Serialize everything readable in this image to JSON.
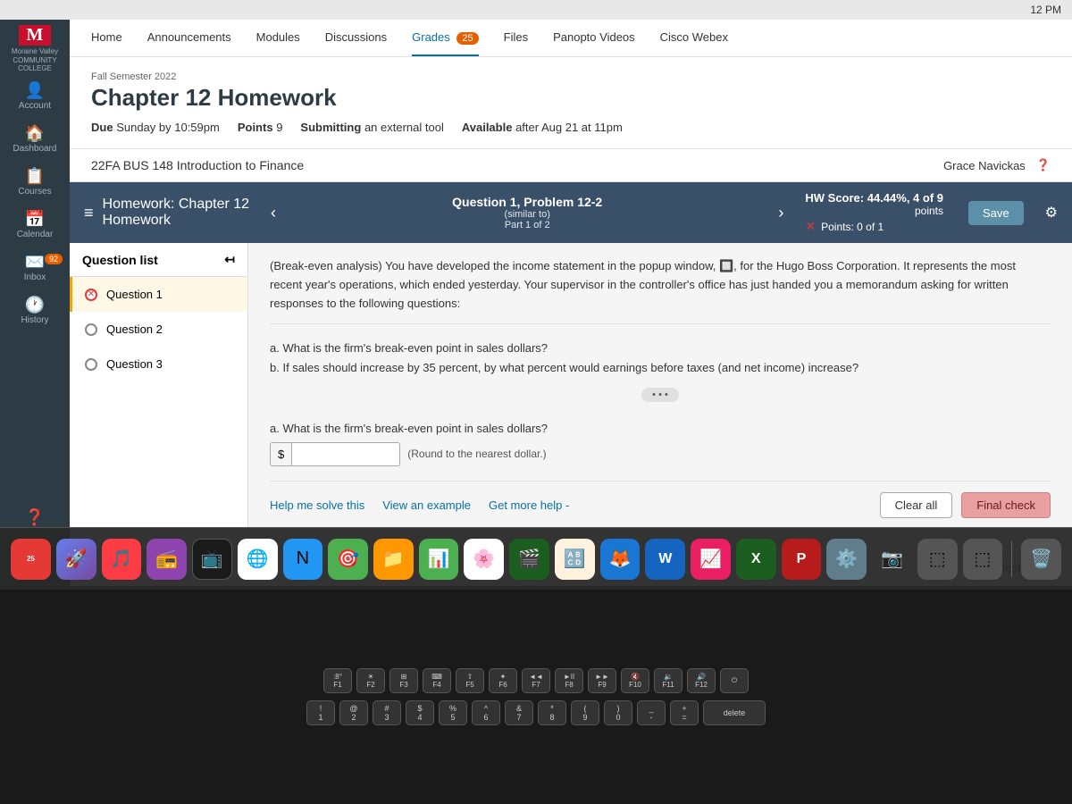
{
  "macos": {
    "time": "12 PM"
  },
  "sidebar": {
    "logo_letter": "M",
    "logo_text": "Moraine Valley\nCOMMUNITY COLLEGE",
    "items": [
      {
        "id": "account",
        "label": "Account",
        "icon": "👤"
      },
      {
        "id": "dashboard",
        "label": "Dashboard",
        "icon": "🏠"
      },
      {
        "id": "courses",
        "label": "Courses",
        "icon": "📋"
      },
      {
        "id": "calendar",
        "label": "Calendar",
        "icon": "📅"
      },
      {
        "id": "inbox",
        "label": "Inbox",
        "icon": "✉️",
        "badge": "92"
      },
      {
        "id": "history",
        "label": "History",
        "icon": "🕐"
      },
      {
        "id": "help",
        "label": "Help",
        "icon": "?"
      }
    ]
  },
  "course_nav": {
    "items": [
      "Home",
      "Announcements",
      "Modules",
      "Discussions",
      "Grades",
      "Files",
      "Panopto Videos",
      "Cisco Webex"
    ],
    "grades_badge": "25",
    "active": "Grades"
  },
  "chapter": {
    "semester": "Fall Semester 2022",
    "title": "Chapter 12 Homework",
    "due": "Sunday by 10:59pm",
    "points": "9",
    "submitting": "an external tool",
    "available": "after Aug 21 at 11pm"
  },
  "course_info": {
    "name": "22FA BUS 148 Introduction to Finance",
    "user": "Grace Navickas"
  },
  "homework": {
    "title_line1": "Homework: Chapter 12",
    "title_line2": "Homework",
    "question_title": "Question 1, Problem 12-2",
    "question_sub1": "(similar to)",
    "question_sub2": "Part 1 of 2",
    "hw_score": "HW Score: 44.44%, 4 of 9",
    "hw_score_sub": "points",
    "points_label": "Points: 0 of 1",
    "save_label": "Save",
    "problem_text": "(Break-even analysis) You have developed the income statement in the popup window, 🔲, for the Hugo Boss Corporation. It represents the most recent year's operations, which ended yesterday. Your supervisor in the controller's office has just handed you a memorandum asking for written responses to the following questions:",
    "questions_text": "a. What is the firm's break-even point in sales dollars?\nb. If sales should increase by 35 percent, by what percent would earnings before taxes (and net income) increase?",
    "answer_label": "a. What is the firm's break-even point in sales dollars?",
    "round_note": "(Round to the nearest dollar.)",
    "questions": [
      {
        "id": 1,
        "label": "Question 1",
        "status": "error"
      },
      {
        "id": 2,
        "label": "Question 2",
        "status": "empty"
      },
      {
        "id": 3,
        "label": "Question 3",
        "status": "empty"
      }
    ]
  },
  "help_bar": {
    "help_me_solve": "Help me solve this",
    "view_example": "View an example",
    "get_more_help": "Get more help -",
    "clear_all": "Clear all",
    "final_check": "Final check"
  },
  "nav": {
    "previous": "◄ Previous",
    "next": "Next ►"
  },
  "dock": {
    "items": [
      "25",
      "🔭",
      "🎵",
      "📻",
      "📺",
      "🌐",
      "⚪",
      "🎯",
      "📁",
      "📊",
      "🖼️",
      "🎬",
      "🔠",
      "📂",
      "🦊",
      "🔤",
      "W",
      "📈",
      "X",
      "P",
      "🖥️",
      "📷",
      "🗑️"
    ]
  }
}
